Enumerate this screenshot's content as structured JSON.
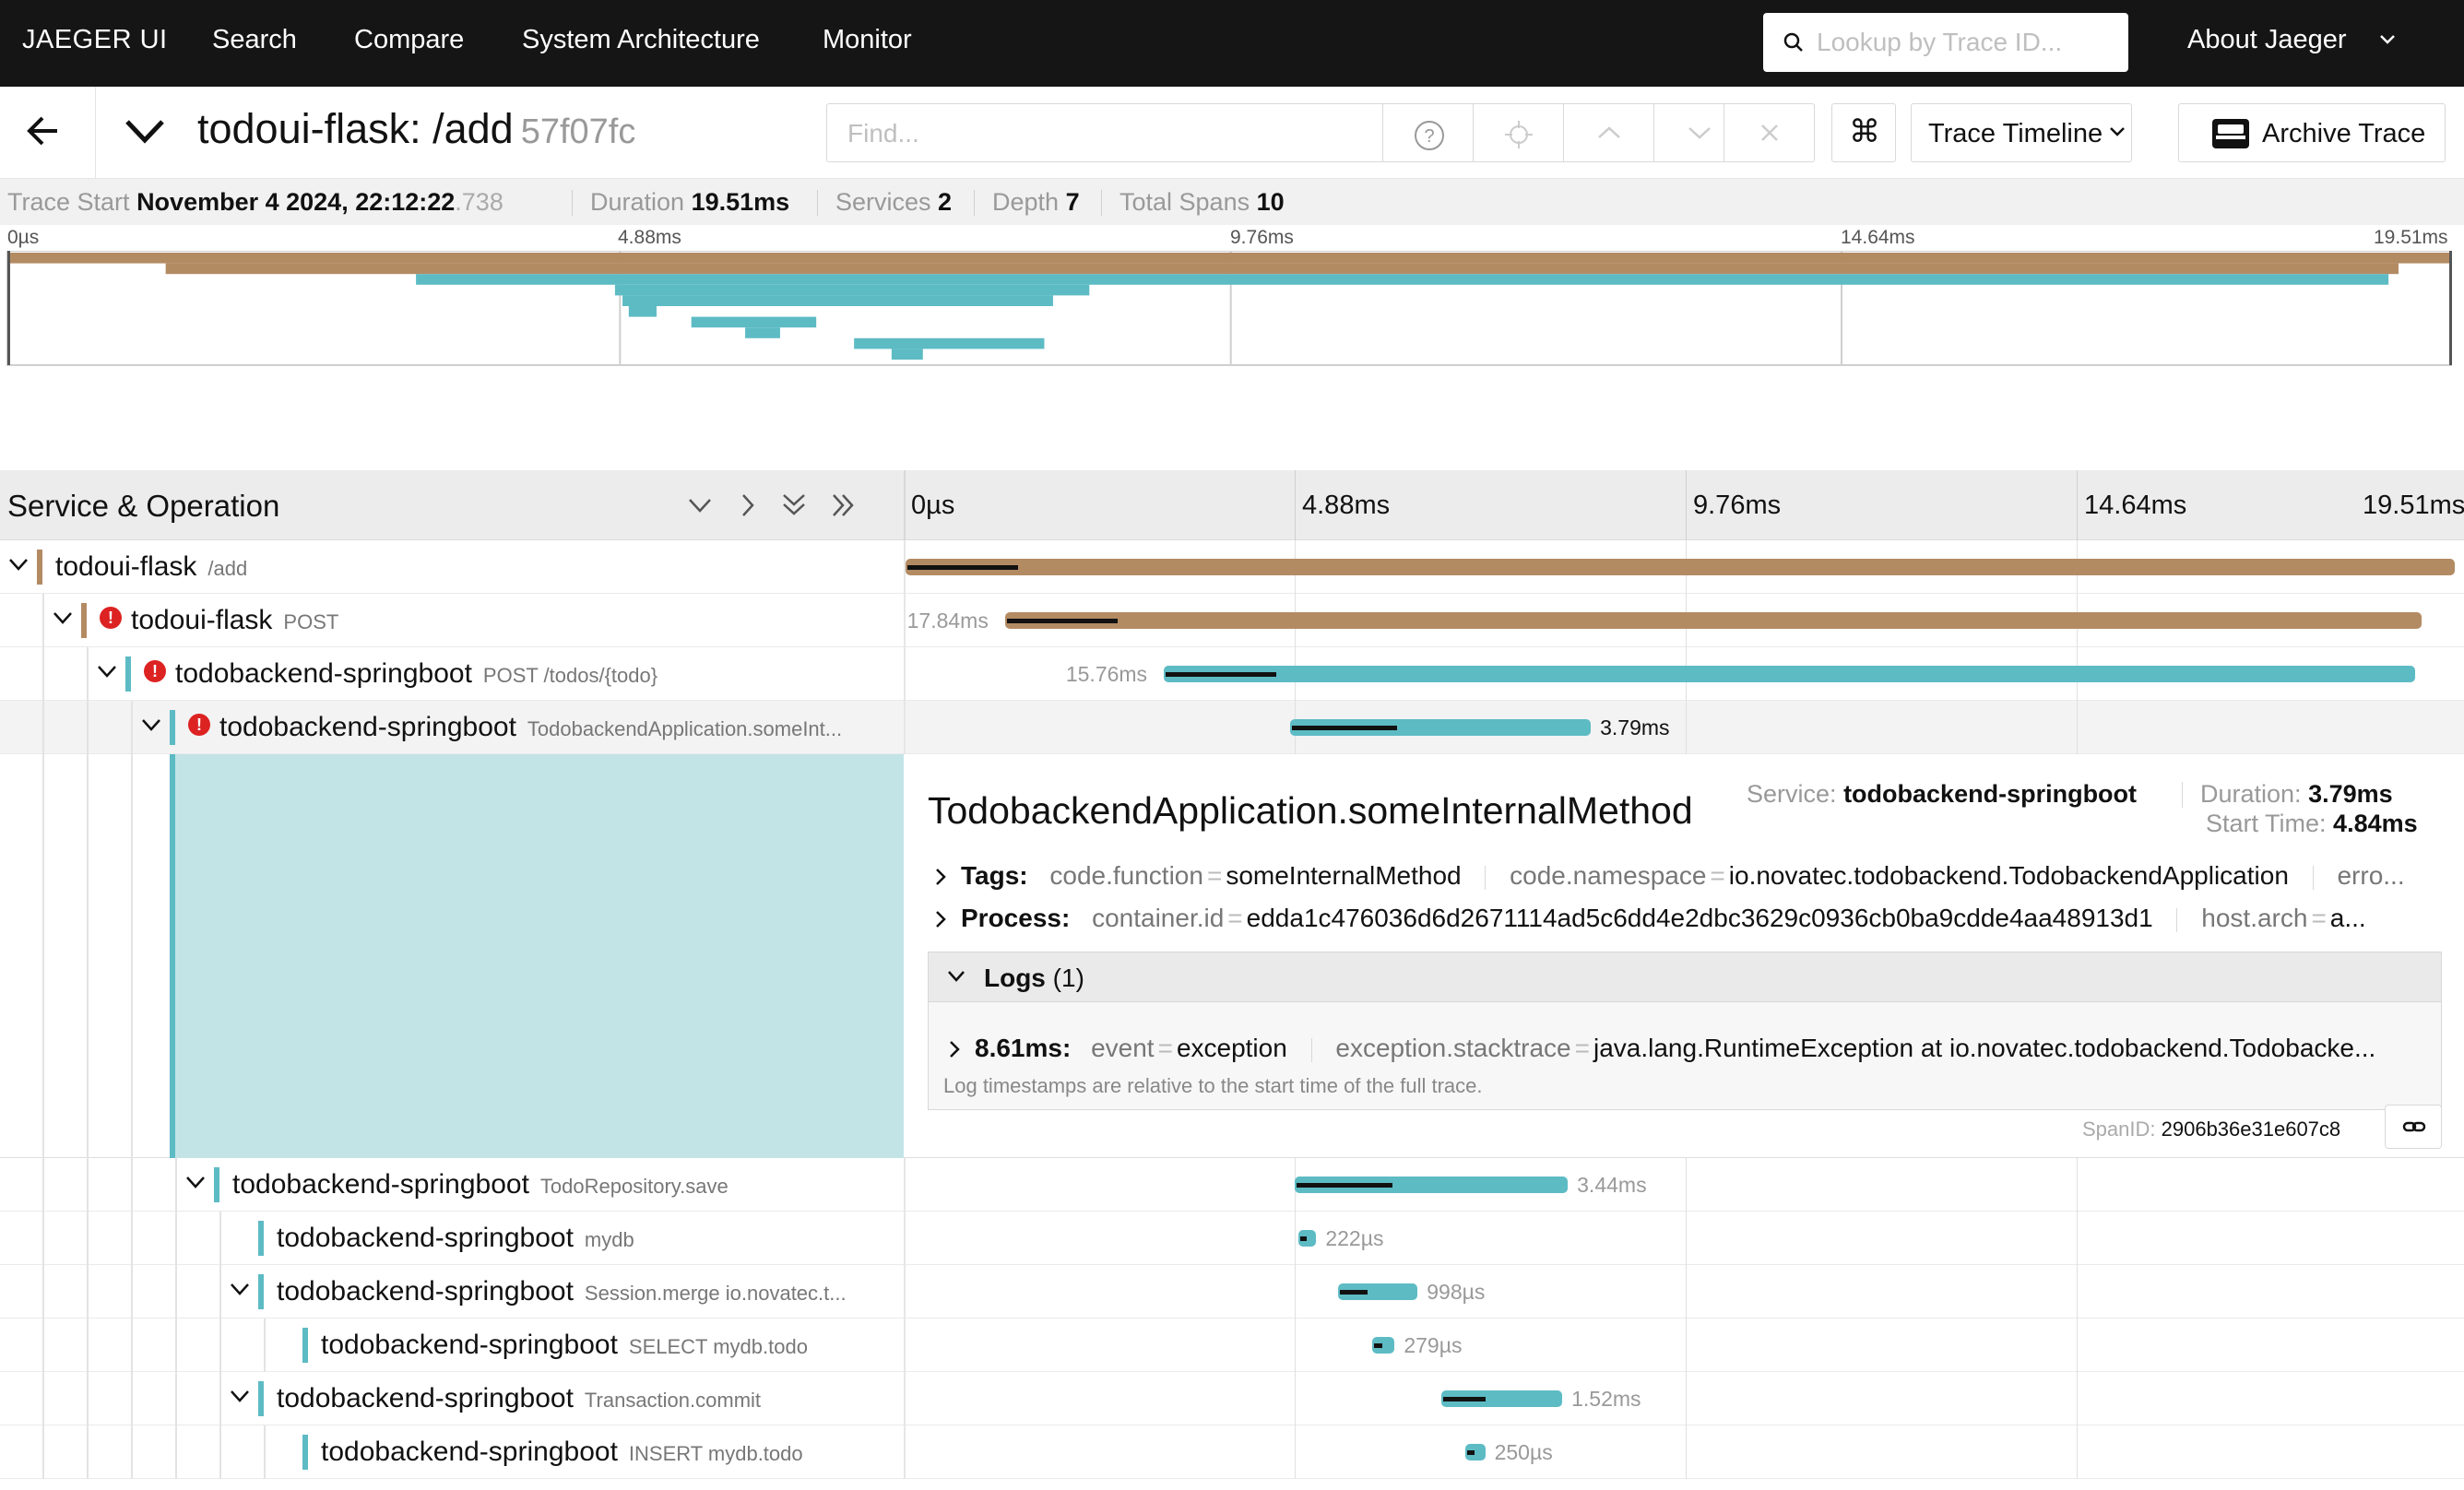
{
  "nav": {
    "brand": "JAEGER UI",
    "items": [
      "Search",
      "Compare",
      "System Architecture",
      "Monitor"
    ],
    "lookup_placeholder": "Lookup by Trace ID...",
    "about": "About Jaeger"
  },
  "trace": {
    "title": "todoui-flask: /add",
    "trace_id": "57f07fc",
    "find_placeholder": "Find...",
    "view_select": "Trace Timeline",
    "archive_label": "Archive Trace"
  },
  "meta": {
    "start_label": "Trace Start",
    "start_value": "November 4 2024, 22:12:22",
    "start_ms": ".738",
    "duration_label": "Duration",
    "duration_value": "19.51ms",
    "services_label": "Services",
    "services_value": "2",
    "depth_label": "Depth",
    "depth_value": "7",
    "spans_label": "Total Spans",
    "spans_value": "10"
  },
  "ticks": [
    "0µs",
    "4.88ms",
    "9.76ms",
    "14.64ms",
    "19.51ms"
  ],
  "table": {
    "header": "Service & Operation"
  },
  "colors": {
    "flask": "#b38b63",
    "springboot": "#5dbbc4",
    "error": "#dd2222"
  },
  "spans": [
    {
      "service": "todoui-flask",
      "operation": "/add",
      "depth": 0,
      "svc_color": "#b38b63",
      "error": false,
      "start": 0,
      "duration": 19.51,
      "label": "",
      "toggle": true
    },
    {
      "service": "todoui-flask",
      "operation": "POST",
      "depth": 1,
      "svc_color": "#b38b63",
      "error": true,
      "start": 1.25,
      "duration": 17.84,
      "label": "17.84ms",
      "toggle": true
    },
    {
      "service": "todobackend-springboot",
      "operation": "POST /todos/{todo}",
      "depth": 2,
      "svc_color": "#5dbbc4",
      "error": true,
      "start": 3.25,
      "duration": 15.76,
      "label": "15.76ms",
      "toggle": true
    },
    {
      "service": "todobackend-springboot",
      "operation": "TodobackendApplication.someInt...",
      "depth": 3,
      "svc_color": "#5dbbc4",
      "error": true,
      "start": 4.84,
      "duration": 3.79,
      "label": "3.79ms",
      "toggle": true,
      "selected": true
    },
    {
      "service": "todobackend-springboot",
      "operation": "TodoRepository.save",
      "depth": 4,
      "svc_color": "#5dbbc4",
      "error": false,
      "start": 4.9,
      "duration": 3.44,
      "label": "3.44ms",
      "toggle": true
    },
    {
      "service": "todobackend-springboot",
      "operation": "mydb",
      "depth": 5,
      "svc_color": "#5dbbc4",
      "error": false,
      "start": 4.95,
      "duration": 0.222,
      "label": "222µs",
      "toggle": false
    },
    {
      "service": "todobackend-springboot",
      "operation": "Session.merge io.novatec.t...",
      "depth": 5,
      "svc_color": "#5dbbc4",
      "error": false,
      "start": 5.45,
      "duration": 0.998,
      "label": "998µs",
      "toggle": true
    },
    {
      "service": "todobackend-springboot",
      "operation": "SELECT mydb.todo",
      "depth": 6,
      "svc_color": "#5dbbc4",
      "error": false,
      "start": 5.88,
      "duration": 0.279,
      "label": "279µs",
      "toggle": false
    },
    {
      "service": "todobackend-springboot",
      "operation": "Transaction.commit",
      "depth": 5,
      "svc_color": "#5dbbc4",
      "error": false,
      "start": 6.75,
      "duration": 1.52,
      "label": "1.52ms",
      "toggle": true
    },
    {
      "service": "todobackend-springboot",
      "operation": "INSERT mydb.todo",
      "depth": 6,
      "svc_color": "#5dbbc4",
      "error": false,
      "start": 7.05,
      "duration": 0.25,
      "label": "250µs",
      "toggle": false
    }
  ],
  "detail": {
    "title": "TodobackendApplication.someInternalMethod",
    "service_label": "Service:",
    "service_value": "todobackend-springboot",
    "duration_label": "Duration:",
    "duration_value": "3.79ms",
    "start_label": "Start Time:",
    "start_value": "4.84ms",
    "tags_label": "Tags:",
    "tags": [
      {
        "key": "code.function",
        "value": "someInternalMethod"
      },
      {
        "key": "code.namespace",
        "value": "io.novatec.todobackend.TodobackendApplication"
      },
      {
        "key": "erro...",
        "value": ""
      }
    ],
    "process_label": "Process:",
    "process": [
      {
        "key": "container.id",
        "value": "edda1c476036d6d2671114ad5c6dd4e2dbc3629c0936cb0ba9cdde4aa48913d1"
      },
      {
        "key": "host.arch",
        "value": "a..."
      }
    ],
    "logs_label": "Logs",
    "logs_count": "(1)",
    "log_time": "8.61ms:",
    "log_fields": [
      {
        "key": "event",
        "value": "exception"
      },
      {
        "key": "exception.stacktrace",
        "value": "java.lang.RuntimeException at io.novatec.todobackend.Todobacke..."
      }
    ],
    "log_note": "Log timestamps are relative to the start time of the full trace.",
    "spanid_label": "SpanID:",
    "spanid_value": "2906b36e31e607c8"
  }
}
